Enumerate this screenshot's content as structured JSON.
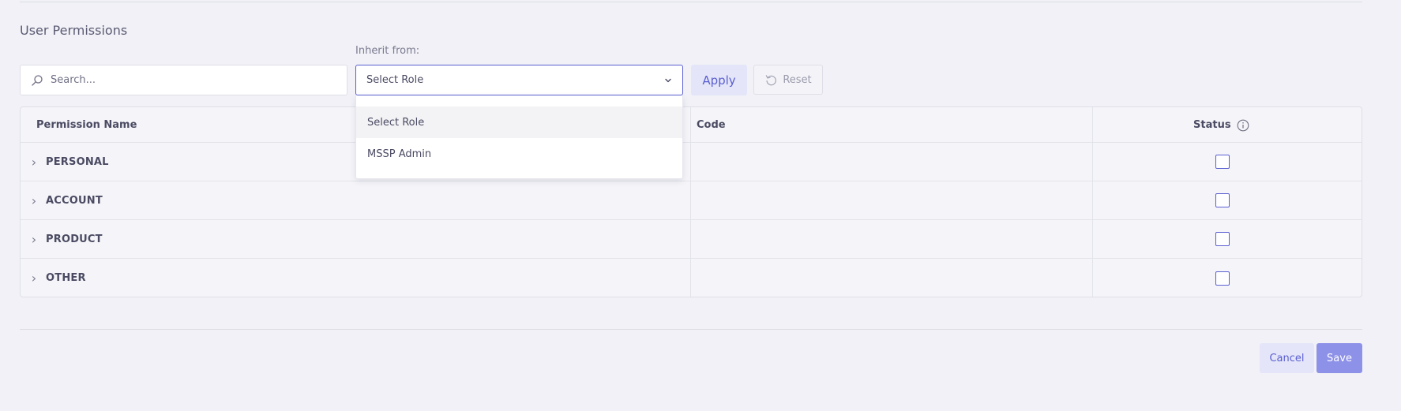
{
  "section_title": "User Permissions",
  "inherit": {
    "label": "Inherit from:",
    "selected": "Select Role",
    "options": [
      "Select Role",
      "MSSP Admin"
    ]
  },
  "search": {
    "placeholder": "Search..."
  },
  "toolbar": {
    "apply_label": "Apply",
    "reset_label": "Reset"
  },
  "table": {
    "headers": {
      "name": "Permission Name",
      "code": "Code",
      "status": "Status"
    },
    "rows": [
      {
        "name": "PERSONAL",
        "code": "",
        "checked": false
      },
      {
        "name": "ACCOUNT",
        "code": "",
        "checked": false
      },
      {
        "name": "PRODUCT",
        "code": "",
        "checked": false
      },
      {
        "name": "OTHER",
        "code": "",
        "checked": false
      }
    ]
  },
  "footer": {
    "cancel_label": "Cancel",
    "save_label": "Save"
  },
  "icons": {
    "search": "search-icon",
    "select_caret": "chevron-down-icon",
    "reset": "reset-icon",
    "info": "info-icon",
    "row_expand": "chevron-right-icon"
  },
  "colors": {
    "accent": "#5a5fd1",
    "accent_light": "#e4e5f8",
    "save_button": "#8d91e8",
    "background": "#f1f1f7"
  }
}
